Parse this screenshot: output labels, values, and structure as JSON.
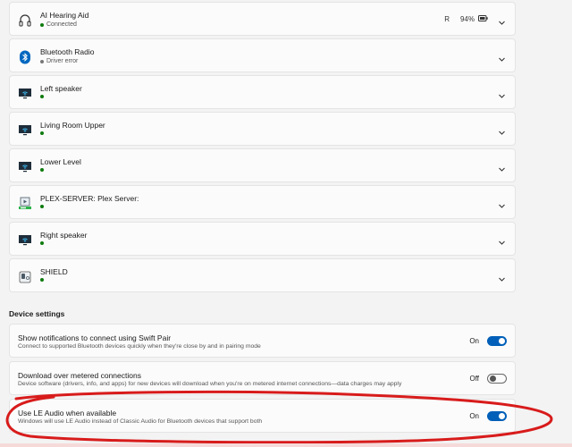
{
  "devices": [
    {
      "name": "AI Hearing Aid",
      "status": "Connected",
      "icon": "headphones-icon",
      "battery_prefix": "R",
      "battery_percent": "94%"
    },
    {
      "name": "Bluetooth Radio",
      "status": "Driver error",
      "icon": "bluetooth-icon"
    },
    {
      "name": "Left speaker",
      "status": "",
      "icon": "display-wifi-icon"
    },
    {
      "name": "Living Room Upper",
      "status": "",
      "icon": "display-wifi-icon"
    },
    {
      "name": "Lower Level",
      "status": "",
      "icon": "display-wifi-icon"
    },
    {
      "name": "PLEX-SERVER: Plex Server:",
      "status": "",
      "icon": "media-server-icon"
    },
    {
      "name": "Right speaker",
      "status": "",
      "icon": "display-wifi-icon"
    },
    {
      "name": "SHIELD",
      "status": "",
      "icon": "device-icon"
    }
  ],
  "device_settings": {
    "title": "Device settings",
    "items": [
      {
        "title": "Show notifications to connect using Swift Pair",
        "description": "Connect to supported Bluetooth devices quickly when they're close by and in pairing mode",
        "state": "On",
        "enabled": true
      },
      {
        "title": "Download over metered connections",
        "description": "Device software (drivers, info, and apps) for new devices will download when you're on metered internet connections—data charges may apply",
        "state": "Off",
        "enabled": false
      },
      {
        "title": "Use LE Audio when available",
        "description": "Windows will use LE Audio instead of Classic Audio for Bluetooth devices that support both",
        "state": "On",
        "enabled": true
      }
    ]
  },
  "colors": {
    "accent": "#005fb8",
    "connected_dot": "#0f7b0f",
    "annotation": "#d81b1b"
  }
}
